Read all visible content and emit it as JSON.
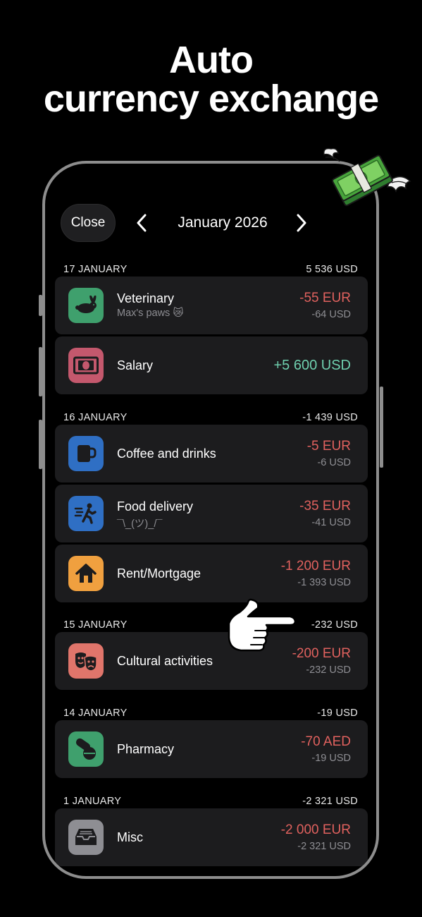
{
  "headline": {
    "line1": "Auto",
    "line2": "currency exchange"
  },
  "topbar": {
    "close_label": "Close",
    "month": "January 2026"
  },
  "sections": [
    {
      "date": "17 JANUARY",
      "total": "5 536 USD",
      "items": [
        {
          "title": "Veterinary",
          "subtitle": "Max's paws 😿",
          "amount": "-55 EUR",
          "converted": "-64 USD",
          "icon": "rabbit-icon",
          "color": "#3fa06d"
        },
        {
          "title": "Salary",
          "subtitle": "",
          "amount": "+5 600 USD",
          "converted": "",
          "icon": "banknote-icon",
          "color": "#c4586d"
        }
      ]
    },
    {
      "date": "16 JANUARY",
      "total": "-1 439 USD",
      "items": [
        {
          "title": "Coffee and drinks",
          "subtitle": "",
          "amount": "-5 EUR",
          "converted": "-6 USD",
          "icon": "mug-icon",
          "color": "#2f6fc4"
        },
        {
          "title": "Food delivery",
          "subtitle": "¯\\_(ツ)_/¯",
          "amount": "-35 EUR",
          "converted": "-41 USD",
          "icon": "runner-icon",
          "color": "#2f6fc4"
        },
        {
          "title": "Rent/Mortgage",
          "subtitle": "",
          "amount": "-1 200 EUR",
          "converted": "-1 393 USD",
          "icon": "house-icon",
          "color": "#f0a03f"
        }
      ]
    },
    {
      "date": "15 JANUARY",
      "total": "-232 USD",
      "items": [
        {
          "title": "Cultural activities",
          "subtitle": "",
          "amount": "-200 EUR",
          "converted": "-232 USD",
          "icon": "theater-masks-icon",
          "color": "#e0756b"
        }
      ]
    },
    {
      "date": "14 JANUARY",
      "total": "-19 USD",
      "items": [
        {
          "title": "Pharmacy",
          "subtitle": "",
          "amount": "-70 AED",
          "converted": "-19 USD",
          "icon": "pills-icon",
          "color": "#3fa06d"
        }
      ]
    },
    {
      "date": "1 JANUARY",
      "total": "-2 321 USD",
      "items": [
        {
          "title": "Misc",
          "subtitle": "",
          "amount": "-2 000 EUR",
          "converted": "-2 321 USD",
          "icon": "tray-icon",
          "color": "#8e8e93"
        }
      ]
    }
  ],
  "colors": {
    "negative": "#e0615e",
    "positive": "#6fcfae",
    "muted": "#8e8e93",
    "card": "#1c1c1e"
  }
}
